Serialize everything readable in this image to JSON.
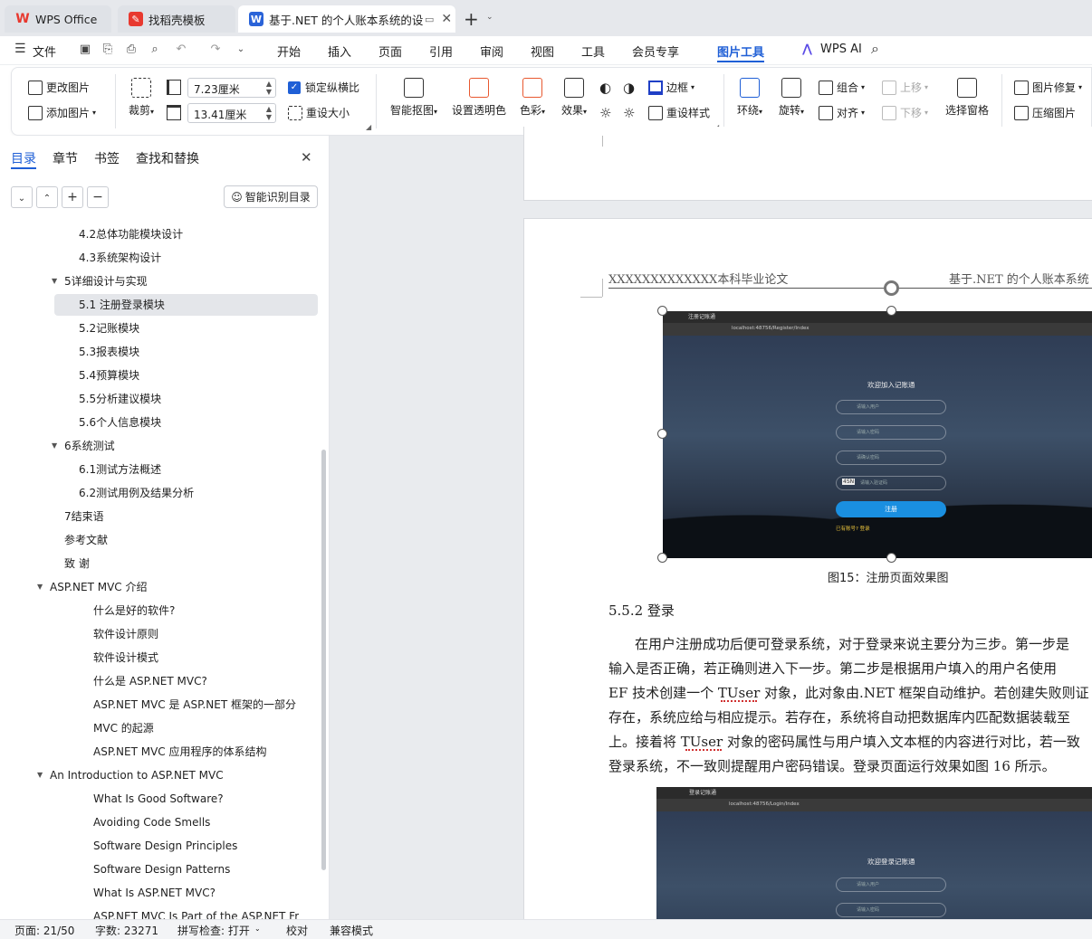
{
  "tabs": [
    {
      "label": "WPS Office",
      "icon": "wps-logo-icon"
    },
    {
      "label": "找稻壳模板",
      "icon": "docer-icon"
    },
    {
      "label": "基于.NET 的个人账本系统的设",
      "icon": "word-doc-icon"
    }
  ],
  "menu": {
    "file": "文件",
    "items": [
      "开始",
      "插入",
      "页面",
      "引用",
      "审阅",
      "视图",
      "工具",
      "会员专享"
    ],
    "active": "图片工具",
    "wps_ai": "WPS AI"
  },
  "ribbon": {
    "change_image": "更改图片",
    "add_image": "添加图片",
    "crop": "裁剪",
    "width_value": "7.23厘米",
    "height_value": "13.41厘米",
    "lock_ratio": "锁定纵横比",
    "reset_size": "重设大小",
    "smart_cutout": "智能抠图",
    "set_transparent": "设置透明色",
    "color": "色彩",
    "effect": "效果",
    "border": "边框",
    "reset_style": "重设样式",
    "wrap": "环绕",
    "rotate": "旋转",
    "group": "组合",
    "align": "对齐",
    "move_up": "上移",
    "move_down": "下移",
    "selection_pane": "选择窗格",
    "image_repair": "图片修复",
    "compress": "压缩图片"
  },
  "sidebar": {
    "tabs": [
      "目录",
      "章节",
      "书签",
      "查找和替换"
    ],
    "smart_toc": "智能识别目录",
    "toc": [
      "4.2总体功能模块设计",
      "4.3系统架构设计",
      "5详细设计与实现",
      "5.1 注册登录模块",
      "5.2记账模块",
      "5.3报表模块",
      "5.4预算模块",
      "5.5分析建议模块",
      "5.6个人信息模块",
      "6系统测试",
      "6.1测试方法概述",
      "6.2测试用例及结果分析",
      "7结束语",
      "参考文献",
      "致 谢",
      "ASP.NET MVC 介绍",
      "什么是好的软件?",
      "软件设计原则",
      "软件设计模式",
      "什么是 ASP.NET MVC?",
      "ASP.NET MVC 是 ASP.NET 框架的一部分",
      "MVC 的起源",
      "ASP.NET MVC 应用程序的体系结构",
      "An Introduction to ASP.NET MVC",
      "What Is Good Software?",
      "Avoiding Code Smells",
      "Software Design Principles",
      "Software Design Patterns",
      "What Is ASP.NET MVC?",
      "ASP.NET MVC Is Part of the ASP.NET Fr"
    ]
  },
  "document": {
    "header_left": "XXXXXXXXXXXXX本科毕业论文",
    "header_right": "基于.NET 的个人账本系统",
    "fig15": {
      "window_title": "注册记账通",
      "url": "localhost:48756/Register/Index",
      "heading": "欢迎加入记账通",
      "fields": [
        "请输入用户",
        "请输入密码",
        "请确认密码",
        "请输入验证码"
      ],
      "captcha": "4SN",
      "button": "注册",
      "link": "已有账号? 登录"
    },
    "caption": "图15：注册页面效果图",
    "section": "5.5.2 登录",
    "para_lines": [
      "在用户注册成功后便可登录系统，对于登录来说主要分为三步。第一步是",
      "输入是否正确，若正确则进入下一步。第二步是根据用户填入的用户名使用",
      "EF 技术创建一个 TUser 对象，此对象由.NET 框架自动维护。若创建失败则证",
      "存在，系统应给与相应提示。若存在，系统将自动把数据库内匹配数据装载至",
      "上。接着将 TUser 对象的密码属性与用户填入文本框的内容进行对比，若一致",
      "登录系统，不一致则提醒用户密码错误。登录页面运行效果如图 16 所示。"
    ],
    "fig16": {
      "window_title": "登录记账通",
      "url": "localhost:48756/Login/Index",
      "heading": "欢迎登录记账通",
      "fields": [
        "请输入用户",
        "请输入密码"
      ]
    }
  },
  "status": {
    "page": "页面: 21/50",
    "words": "字数: 23271",
    "spell": "拼写检查: 打开",
    "proof": "校对",
    "compat": "兼容模式"
  },
  "colors": {
    "accent": "#1f5fd6",
    "wps_red": "#e8392f",
    "register_button": "#1a8fe0"
  }
}
